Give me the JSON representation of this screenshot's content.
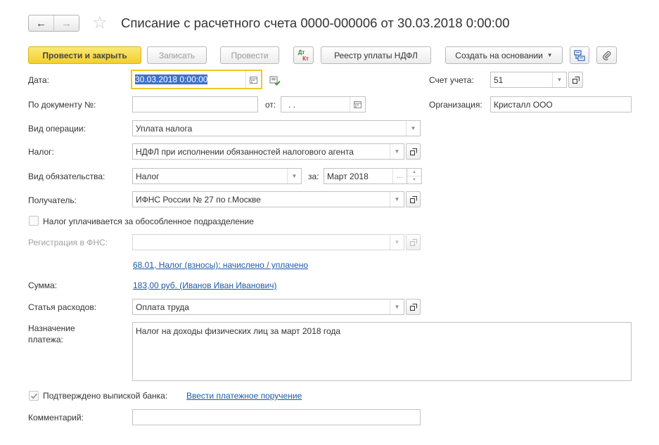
{
  "window": {
    "title": "Списание с расчетного счета 0000-000006 от 30.03.2018 0:00:00",
    "back_icon": "←",
    "forward_icon": "→",
    "favorite_icon": "☆"
  },
  "toolbar": {
    "post_and_close": "Провести и закрыть",
    "save": "Записать",
    "post": "Провести",
    "dt_kt_top": "Дт",
    "dt_kt_bottom": "Кт",
    "ndfl_registry": "Реестр уплаты НДФЛ",
    "create_based_on": "Создать на основании"
  },
  "form": {
    "date": {
      "label": "Дата:",
      "value": "30.03.2018  0:00:00"
    },
    "account": {
      "label": "Счет учета:",
      "value": "51"
    },
    "doc_number": {
      "label": "По документу №:",
      "value": ""
    },
    "from": {
      "label": "от:",
      "value": " .  .  "
    },
    "organization": {
      "label": "Организация:",
      "value": "Кристалл ООО"
    },
    "operation_type": {
      "label": "Вид операции:",
      "value": "Уплата налога"
    },
    "tax": {
      "label": "Налог:",
      "value": "НДФЛ при исполнении обязанностей налогового агента"
    },
    "obligation_type": {
      "label": "Вид обязательства:",
      "value": "Налог"
    },
    "period": {
      "label": "за:",
      "value": "Март 2018"
    },
    "recipient": {
      "label": "Получатель:",
      "value": "ИФНС России № 27 по г.Москве"
    },
    "separate_division": {
      "label": "Налог уплачивается за обособленное подразделение",
      "checked": false
    },
    "fns_registration": {
      "label": "Регистрация в ФНС:",
      "value": ""
    },
    "account_link": "68.01, Налог (взносы): начислено / уплачено",
    "amount": {
      "label": "Сумма:",
      "link": "183,00 руб. (Иванов Иван Иванович)"
    },
    "expense_item": {
      "label": "Статья расходов:",
      "value": "Оплата труда"
    },
    "purpose": {
      "label_line1": "Назначение",
      "label_line2": "платежа:",
      "value": "Налог на доходы физических лиц за март 2018 года"
    },
    "bank_confirmed": {
      "label": "Подтверждено выпиской банка:",
      "checked": true,
      "link": "Ввести платежное поручение"
    },
    "comment": {
      "label": "Комментарий:",
      "value": ""
    }
  }
}
